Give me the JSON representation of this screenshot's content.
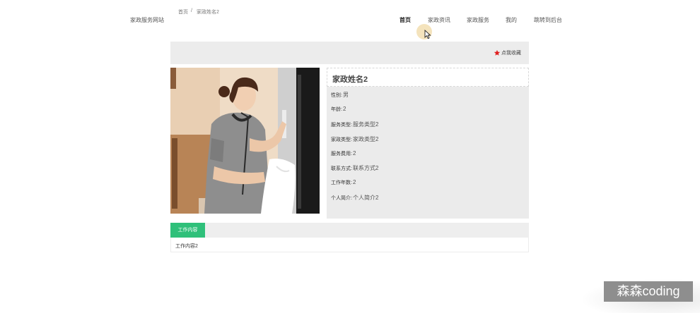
{
  "header": {
    "site_name": "家政服务网站",
    "nav": [
      {
        "label": "首页"
      },
      {
        "label": "家政资讯"
      },
      {
        "label": "家政服务"
      },
      {
        "label": "我的"
      },
      {
        "label": "跳转到后台"
      }
    ]
  },
  "breadcrumb": {
    "home": "首页",
    "sep": "/",
    "current": "家政姓名2"
  },
  "favorite": {
    "label": "点我收藏",
    "icon": "star-icon",
    "color": "#e02020"
  },
  "detail": {
    "title": "家政姓名2",
    "fields": [
      {
        "label": "性别:",
        "value": "男"
      },
      {
        "label": "年龄:",
        "value": "2"
      },
      {
        "label": "服务类型:",
        "value": "服务类型2"
      },
      {
        "label": "家政类型:",
        "value": "家政类型2"
      },
      {
        "label": "服务费用:",
        "value": "2"
      },
      {
        "label": "联系方式:",
        "value": "联系方式2"
      },
      {
        "label": "工作年数:",
        "value": "2"
      },
      {
        "label": "个人简介:",
        "value": "个人简介2"
      }
    ]
  },
  "tabs": {
    "active_label": "工作内容",
    "content": "工作内容2",
    "accent": "#2fc07a"
  },
  "watermark": "森森coding"
}
